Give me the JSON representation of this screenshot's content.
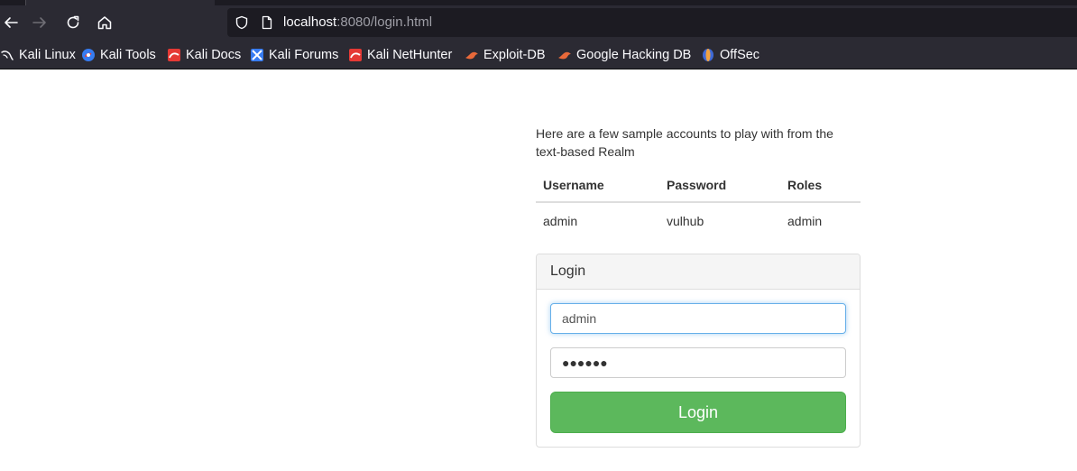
{
  "browser": {
    "url_host": "localhost",
    "url_path": ":8080/login.html"
  },
  "bookmarks": [
    {
      "label": "Kali Linux",
      "icon": "kali-dragon-icon"
    },
    {
      "label": "Kali Tools",
      "icon": "kali-tools-icon"
    },
    {
      "label": "Kali Docs",
      "icon": "kali-docs-icon"
    },
    {
      "label": "Kali Forums",
      "icon": "kali-forums-icon"
    },
    {
      "label": "Kali NetHunter",
      "icon": "kali-nethunter-icon"
    },
    {
      "label": "Exploit-DB",
      "icon": "exploit-db-icon"
    },
    {
      "label": "Google Hacking DB",
      "icon": "ghdb-icon"
    },
    {
      "label": "OffSec",
      "icon": "offsec-icon"
    }
  ],
  "page": {
    "intro": "Here are a few sample accounts to play with from the text-based Realm",
    "table": {
      "headers": [
        "Username",
        "Password",
        "Roles"
      ],
      "rows": [
        [
          "admin",
          "vulhub",
          "admin"
        ]
      ]
    },
    "login_panel": {
      "heading": "Login",
      "username_value": "admin",
      "password_value": "●●●●●●",
      "button_label": "Login"
    }
  },
  "colors": {
    "chrome_bg": "#2b2a33",
    "urlbar_bg": "#1c1b22",
    "button_green": "#5cb85c",
    "focus_blue": "#66afe9"
  }
}
